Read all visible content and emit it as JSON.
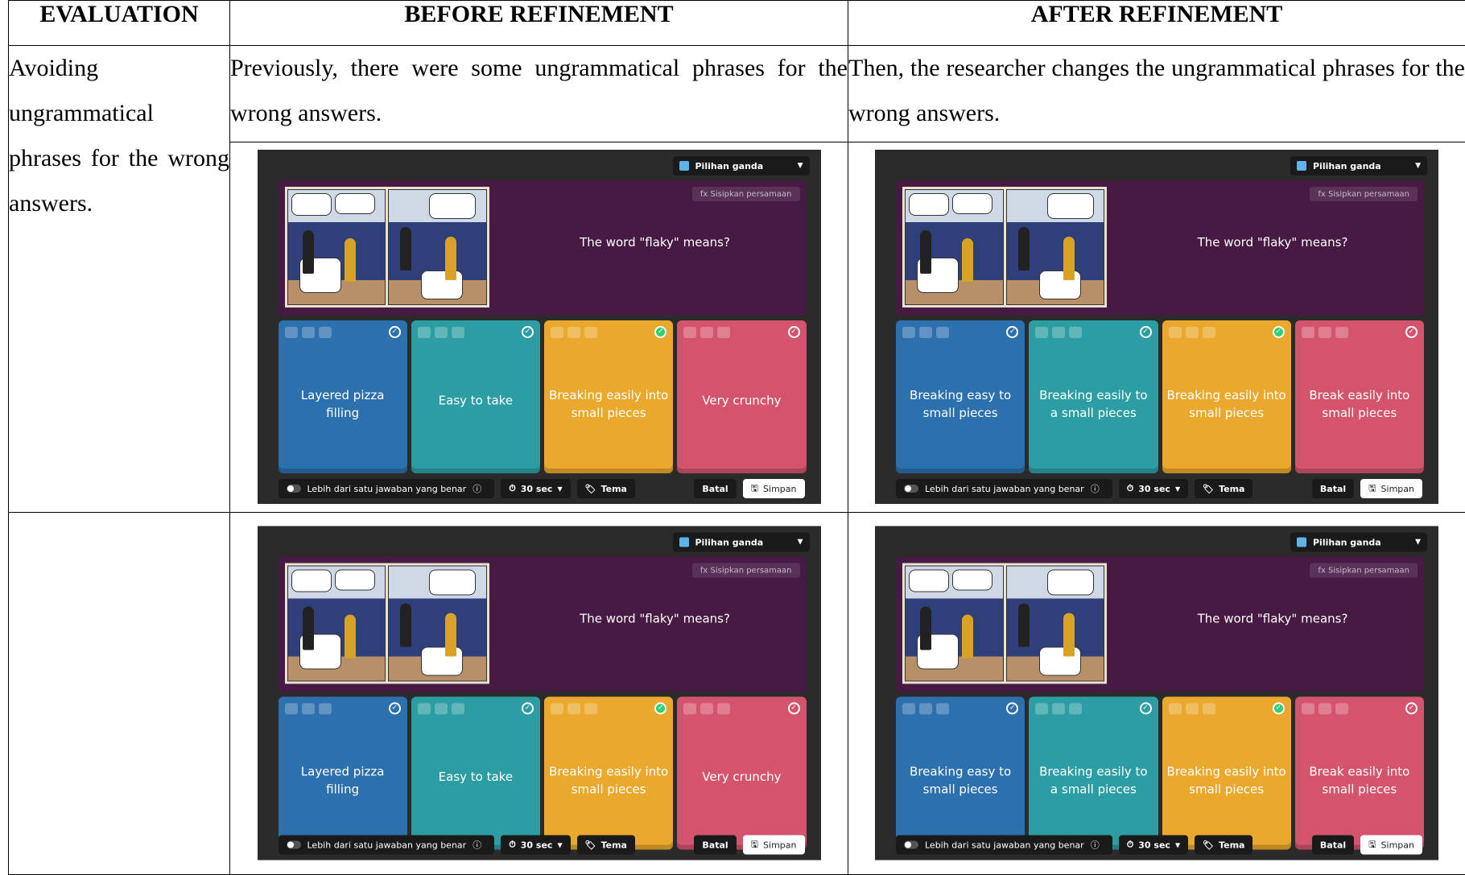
{
  "headers": {
    "evaluation": "EVALUATION",
    "before": "BEFORE REFINEMENT",
    "after": "AFTER REFINEMENT"
  },
  "row1": {
    "evaluation": "Avoiding ungrammatical phrases for the wrong answers.",
    "before_note": "Previously, there were some ungrammatical phrases for the wrong answers.",
    "after_note": "Then, the researcher changes the ungrammatical phrases for the wrong answers."
  },
  "editor_ui": {
    "type_dropdown": "Pilihan ganda",
    "formula_button": "fx Sisipkan persamaan",
    "question": "The word \"flaky\" means?",
    "multi_answer_toggle": "Lebih dari satu jawaban yang benar",
    "timer": "30 sec",
    "theme": "Tema",
    "cancel": "Batal",
    "save": "Simpan"
  },
  "before_answers": [
    "Layered pizza filling",
    "Easy to take",
    "Breaking easily into small pieces",
    "Very crunchy"
  ],
  "after_answers": [
    "Breaking easy to small pieces",
    "Breaking easily to a small pieces",
    "Breaking easily into small pieces",
    "Break easily into small pieces"
  ],
  "correct_answer_index": 3,
  "answer_colors": [
    "#2d70ae",
    "#2c9ea3",
    "#eaa82d",
    "#d5546d"
  ]
}
